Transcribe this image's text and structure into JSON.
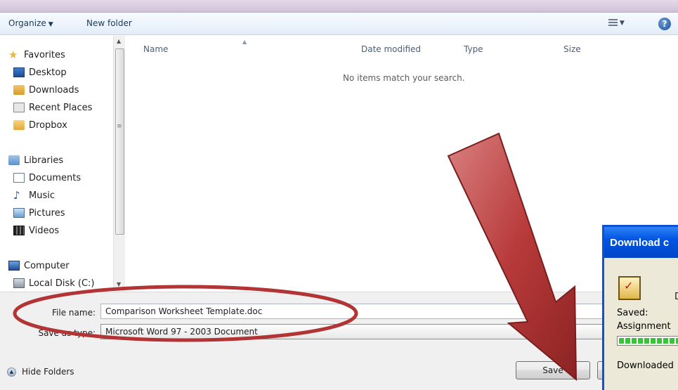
{
  "toolbar": {
    "organize_label": "Organize",
    "new_folder_label": "New folder",
    "help_label": "?"
  },
  "nav": {
    "favorites_label": "Favorites",
    "favorites_items": [
      "Desktop",
      "Downloads",
      "Recent Places",
      "Dropbox"
    ],
    "libraries_label": "Libraries",
    "libraries_items": [
      "Documents",
      "Music",
      "Pictures",
      "Videos"
    ],
    "computer_label": "Computer",
    "computer_items": [
      "Local Disk (C:)"
    ]
  },
  "columns": {
    "name": "Name",
    "date_modified": "Date modified",
    "type": "Type",
    "size": "Size"
  },
  "content": {
    "empty_message": "No items match your search."
  },
  "form": {
    "file_name_label": "File name:",
    "file_name_value": "Comparison Worksheet Template.doc",
    "save_as_type_label": "Save as type:",
    "save_as_type_value": "Microsoft Word 97 - 2003 Document"
  },
  "footer": {
    "hide_folders_label": "Hide Folders",
    "save_label": "Save"
  },
  "download_window": {
    "title": "Download c",
    "label_truncated": "D",
    "saved_label": "Saved:",
    "assignment_label": "Assignment",
    "downloaded_label": "Downloaded",
    "progress_fraction": 1.0
  },
  "annotations": {
    "arrow_color": "#b83a3a",
    "ellipse_color": "#b23434"
  }
}
